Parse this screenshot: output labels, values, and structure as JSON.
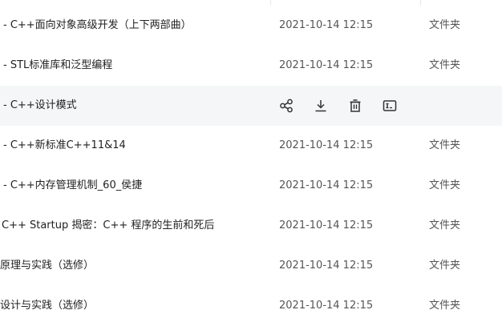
{
  "file_list": {
    "rows": [
      {
        "name": "- C++面向对象高级开发（上下两部曲）",
        "date": "2021-10-14 12:15",
        "type": "文件夹"
      },
      {
        "name": "- STL标准库和泛型编程",
        "date": "2021-10-14 12:15",
        "type": "文件夹"
      },
      {
        "name": "-  C++设计模式",
        "date": "",
        "type": ""
      },
      {
        "name": "- C++新标准C++11&14",
        "date": "2021-10-14 12:15",
        "type": "文件夹"
      },
      {
        "name": "- C++内存管理机制_60_侯捷",
        "date": "2021-10-14 12:15",
        "type": "文件夹"
      },
      {
        "name": "C++ Startup 揭密：C++ 程序的生前和死后",
        "date": "2021-10-14 12:15",
        "type": "文件夹"
      },
      {
        "name": "原理与实践（选修）",
        "date": "2021-10-14 12:15",
        "type": "文件夹"
      },
      {
        "name": "设计与实践（选修）",
        "date": "2021-10-14 12:15",
        "type": "文件夹"
      }
    ],
    "hover_actions": [
      {
        "icon": "share-icon"
      },
      {
        "icon": "download-icon"
      },
      {
        "icon": "delete-icon"
      },
      {
        "icon": "rename-icon"
      }
    ]
  },
  "colors": {
    "row_hover_bg": "#f5f6f8",
    "text_primary": "#222222",
    "text_secondary": "#555555",
    "icon": "#333333"
  }
}
